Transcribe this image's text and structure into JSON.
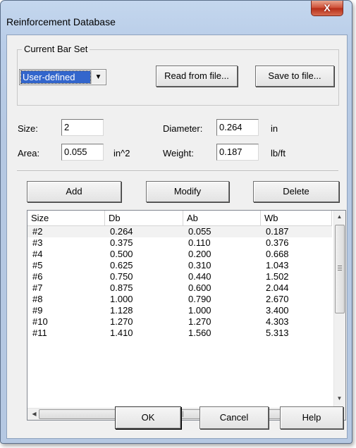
{
  "window": {
    "title": "Reinforcement Database",
    "close_glyph": "X"
  },
  "bar_set": {
    "group_label": "Current Bar Set",
    "selected": "User-defined",
    "dropdown_icon": "chevron-down-icon",
    "read_label": "Read from file...",
    "save_label": "Save to file..."
  },
  "fields": {
    "size_label": "Size:",
    "size_value": "2",
    "diameter_label": "Diameter:",
    "diameter_value": "0.264",
    "diameter_unit": "in",
    "area_label": "Area:",
    "area_value": "0.055",
    "area_unit": "in^2",
    "weight_label": "Weight:",
    "weight_value": "0.187",
    "weight_unit": "lb/ft"
  },
  "actions": {
    "add": "Add",
    "modify": "Modify",
    "delete": "Delete"
  },
  "table": {
    "columns": [
      "Size",
      "Db",
      "Ab",
      "Wb"
    ],
    "rows": [
      [
        "#2",
        "0.264",
        "0.055",
        "0.187"
      ],
      [
        "#3",
        "0.375",
        "0.110",
        "0.376"
      ],
      [
        "#4",
        "0.500",
        "0.200",
        "0.668"
      ],
      [
        "#5",
        "0.625",
        "0.310",
        "1.043"
      ],
      [
        "#6",
        "0.750",
        "0.440",
        "1.502"
      ],
      [
        "#7",
        "0.875",
        "0.600",
        "2.044"
      ],
      [
        "#8",
        "1.000",
        "0.790",
        "2.670"
      ],
      [
        "#9",
        "1.128",
        "1.000",
        "3.400"
      ],
      [
        "#10",
        "1.270",
        "1.270",
        "4.303"
      ],
      [
        "#11",
        "1.410",
        "1.560",
        "5.313"
      ]
    ],
    "selected_row": 0
  },
  "footer": {
    "ok": "OK",
    "cancel": "Cancel",
    "help": "Help"
  },
  "colors": {
    "selection": "#3366cc",
    "close_button": "#c8412a",
    "title_bar": "#c4d7ee"
  }
}
